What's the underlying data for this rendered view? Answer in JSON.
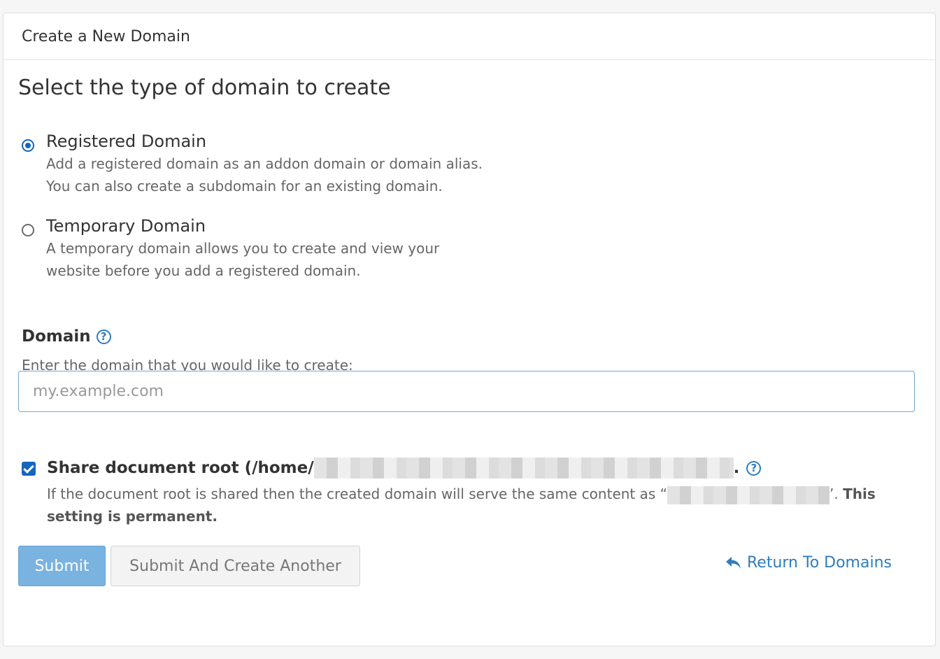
{
  "panel": {
    "title": "Create a New Domain"
  },
  "type_section": {
    "heading": "Select the type of domain to create",
    "options": [
      {
        "label": "Registered Domain",
        "desc_line1": "Add a registered domain as an addon domain or domain alias.",
        "desc_line2": "You can also create a subdomain for an existing domain.",
        "selected": true
      },
      {
        "label": "Temporary Domain",
        "desc_line1": "A temporary domain allows you to create and view your",
        "desc_line2": "website before you add a registered domain.",
        "selected": false
      }
    ]
  },
  "domain_field": {
    "label": "Domain",
    "help_icon": "question-circle-icon",
    "help_text": "Enter the domain that you would like to create:",
    "placeholder": "my.example.com",
    "value": ""
  },
  "share_root": {
    "checked": true,
    "label_prefix": "Share document root (/home/",
    "label_suffix": ".",
    "desc_prefix": "If the document root is shared then the created domain will serve the same content as “",
    "desc_suffix": "’.",
    "desc_bold_1": "This",
    "desc_bold_2": "setting is permanent."
  },
  "buttons": {
    "submit": "Submit",
    "submit_another": "Submit And Create Another",
    "return": "Return To Domains",
    "return_icon": "reply-arrow-icon"
  },
  "colors": {
    "accent": "#1565c0",
    "link": "#2d7dc0",
    "primary_button": "#7ab2e0"
  }
}
